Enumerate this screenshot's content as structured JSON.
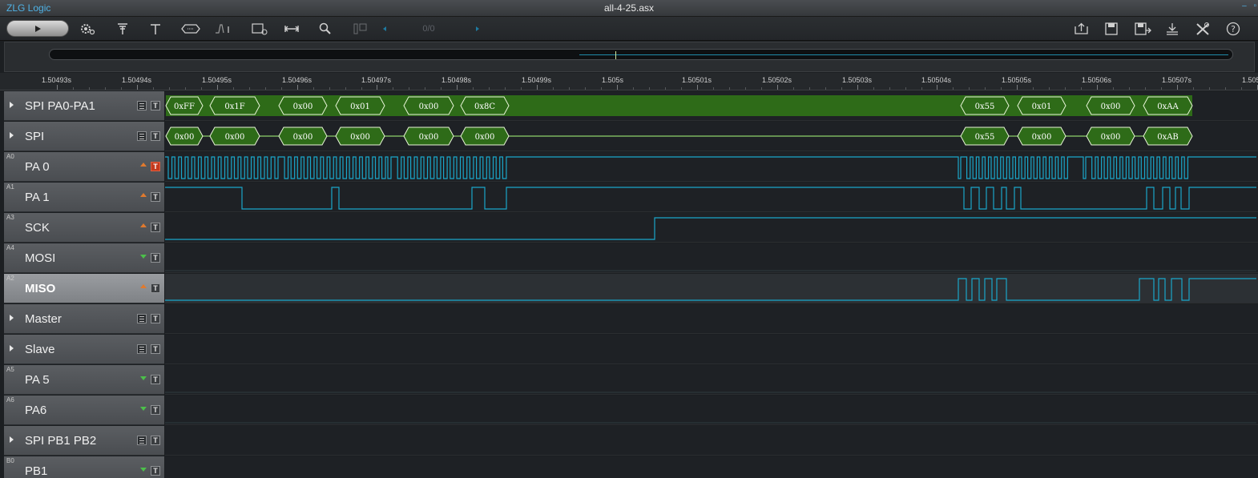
{
  "title_bar": {
    "app_name": "ZLG Logic",
    "file_name": "all-4-25.asx",
    "controls": [
      "–",
      "▫"
    ]
  },
  "toolbar": {
    "page_counter": "0/0",
    "icons": [
      "run-icon",
      "settings-icon",
      "trigger-icon",
      "text-icon",
      "bus-decode-icon",
      "pulse-icon",
      "measure-icon",
      "fit-width-icon",
      "search-icon",
      "column-icon",
      "prev-icon",
      "next-icon",
      "export-icon",
      "save-icon",
      "save-as-icon",
      "download-icon",
      "tools-icon",
      "help-icon"
    ]
  },
  "colors": {
    "signal": "#1aa6c9",
    "bus_fill": "#2e6b18",
    "bus_line": "#8ed26a",
    "edge_rising": "#e07a2e",
    "edge_falling": "#4cc04a",
    "app_name": "#4fb2e6"
  },
  "ruler": {
    "labels": [
      "1.50493s",
      "1.50494s",
      "1.50495s",
      "1.50496s",
      "1.50497s",
      "1.50498s",
      "1.50499s",
      "1.505s",
      "1.50501s",
      "1.50502s",
      "1.50503s",
      "1.50504s",
      "1.50505s",
      "1.50506s",
      "1.50507s",
      "1.505"
    ]
  },
  "channels": [
    {
      "code": "",
      "name": "SPI PA0-PA1",
      "kind": "bus",
      "expandable": true
    },
    {
      "code": "",
      "name": "SPI",
      "kind": "bus",
      "expandable": true
    },
    {
      "code": "A0",
      "name": "PA 0",
      "kind": "digital",
      "edge": "rising",
      "trigger_active": true
    },
    {
      "code": "A1",
      "name": "PA 1",
      "kind": "digital",
      "edge": "rising"
    },
    {
      "code": "A3",
      "name": "SCK",
      "kind": "digital",
      "edge": "rising"
    },
    {
      "code": "A4",
      "name": "MOSI",
      "kind": "digital",
      "edge": "falling"
    },
    {
      "code": "A2",
      "name": "MISO",
      "kind": "digital",
      "edge": "rising",
      "selected": true
    },
    {
      "code": "",
      "name": "Master",
      "kind": "bus",
      "expandable": true
    },
    {
      "code": "",
      "name": "Slave",
      "kind": "bus",
      "expandable": true
    },
    {
      "code": "A5",
      "name": "PA 5",
      "kind": "digital",
      "edge": "falling"
    },
    {
      "code": "A6",
      "name": "PA6",
      "kind": "digital",
      "edge": "falling"
    },
    {
      "code": "",
      "name": "SPI PB1 PB2",
      "kind": "bus",
      "expandable": true
    },
    {
      "code": "B0",
      "name": "PB1",
      "kind": "digital",
      "edge": "falling"
    }
  ],
  "decoded": {
    "spi_pa0_pa1": [
      "0xFF",
      "0x1F",
      "0x00",
      "0x01",
      "0x00",
      "0x8C",
      "0x55",
      "0x01",
      "0x00",
      "0xAA"
    ],
    "spi": [
      "0x00",
      "0x00",
      "0x00",
      "0x00",
      "0x00",
      "0x00",
      "0x55",
      "0x00",
      "0x00",
      "0xAB"
    ]
  }
}
